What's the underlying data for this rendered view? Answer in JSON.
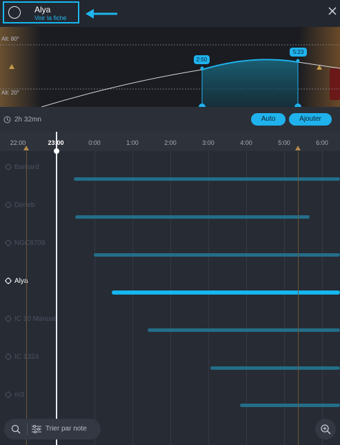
{
  "header": {
    "object_name": "Alya",
    "view_link": "Voir la fiche"
  },
  "altitude_chart": {
    "alt_top_label": "Alt: 80°",
    "alt_bottom_label": "Alt: 20°",
    "start_marker": "2:50",
    "end_marker": "5:23"
  },
  "toolbar": {
    "duration": "2h 32mn",
    "auto_label": "Auto",
    "add_label": "Ajouter"
  },
  "timeline": {
    "ticks": [
      "22:00",
      "23:00",
      "0:00",
      "1:00",
      "2:00",
      "3:00",
      "4:00",
      "5:00",
      "6:00"
    ],
    "current_time": "23:00",
    "rows": [
      {
        "name": "Barnard",
        "active": false
      },
      {
        "name": "Deneb",
        "active": false
      },
      {
        "name": "NGC6709",
        "active": false
      },
      {
        "name": "Alya",
        "active": true
      },
      {
        "name": "IC 10 Manual",
        "active": false
      },
      {
        "name": "IC 1324",
        "active": false
      },
      {
        "name": "m3",
        "active": false
      }
    ]
  },
  "bottom": {
    "sort_label": "Trier par note"
  },
  "colors": {
    "accent": "#1fb2ec",
    "background": "#272b34"
  },
  "icons": [
    "search-icon",
    "filter-icon",
    "zoom-in-icon",
    "close-icon",
    "clock-icon",
    "target-icon",
    "arrow-left-icon",
    "twilight-icon"
  ]
}
